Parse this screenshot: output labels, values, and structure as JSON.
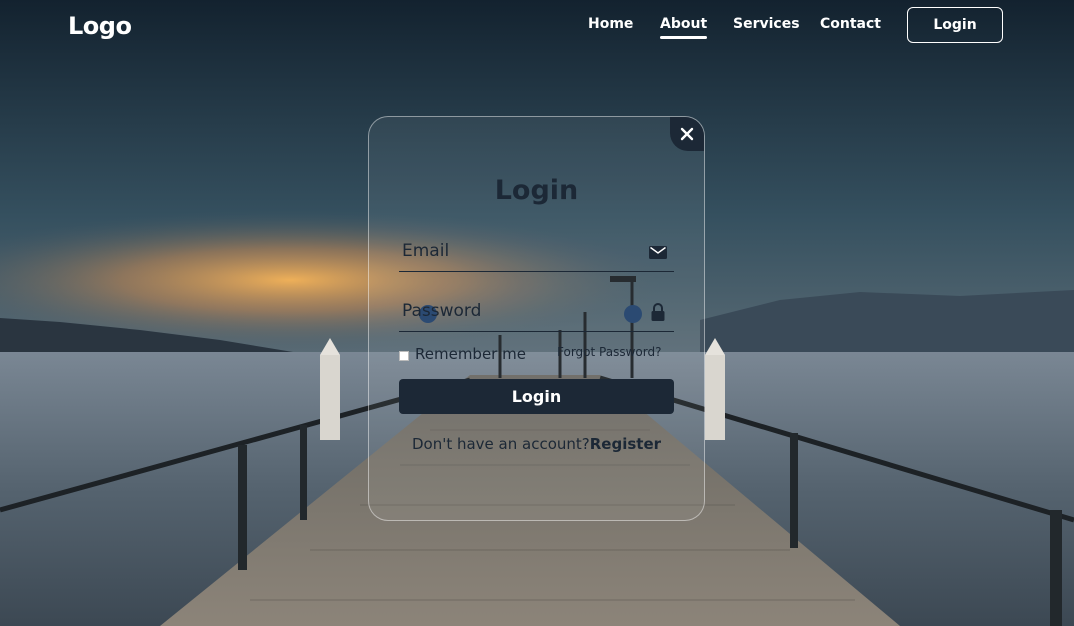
{
  "header": {
    "logo": "Logo",
    "nav": [
      {
        "label": "Home",
        "active": false
      },
      {
        "label": "About",
        "active": true
      },
      {
        "label": "Services",
        "active": false
      },
      {
        "label": "Contact",
        "active": false
      }
    ],
    "login_button": "Login"
  },
  "login_form": {
    "title": "Login",
    "email_placeholder": "Email",
    "password_placeholder": "Password",
    "remember_label": "Remember me",
    "forgot_link": "Forgot Password?",
    "submit_label": "Login",
    "register_prompt": "Don't have an account?",
    "register_link": "Register"
  },
  "icons": {
    "close": "close-icon",
    "email": "mail-icon",
    "password": "lock-icon"
  },
  "colors": {
    "primary_dark": "#1c2836",
    "text_light": "#ffffff"
  }
}
